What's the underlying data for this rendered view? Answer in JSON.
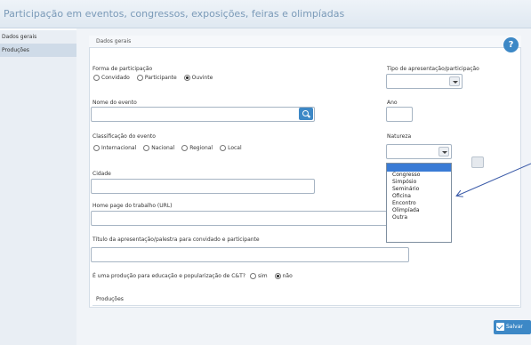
{
  "header": {
    "title": "Participação em eventos, congressos, exposições, feiras e olimpíadas"
  },
  "sidebar": {
    "items": [
      {
        "label": "Dados gerais"
      },
      {
        "label": "Produções"
      }
    ]
  },
  "tab": {
    "label": "Dados gerais"
  },
  "form": {
    "forma_participacao": {
      "label": "Forma de participação",
      "options": [
        {
          "label": "Convidado"
        },
        {
          "label": "Participante"
        },
        {
          "label": "Ouvinte",
          "selected": true
        }
      ]
    },
    "tipo_apresentacao": {
      "label": "Tipo de apresentação/participação",
      "value": ""
    },
    "nome_evento": {
      "label": "Nome do evento",
      "value": ""
    },
    "ano": {
      "label": "Ano",
      "value": ""
    },
    "classificacao": {
      "label": "Classificação do evento",
      "options": [
        {
          "label": "Internacional"
        },
        {
          "label": "Nacional"
        },
        {
          "label": "Regional"
        },
        {
          "label": "Local"
        }
      ]
    },
    "natureza": {
      "label": "Natureza",
      "value": "",
      "options": [
        "",
        "Congresso",
        "Simpósio",
        "Seminário",
        "Oficina",
        "Encontro",
        "Olimpíada",
        "Outra"
      ]
    },
    "cidade": {
      "label": "Cidade",
      "value": ""
    },
    "home_page": {
      "label": "Home page do trabalho (URL)",
      "value": ""
    },
    "titulo_apresentacao": {
      "label": "Título da apresentação/palestra para convidado e participante",
      "value": ""
    },
    "producao_educacao": {
      "label": "É uma produção para educação e popularização de C&T?",
      "options": [
        {
          "label": "sim"
        },
        {
          "label": "não",
          "selected": true
        }
      ]
    }
  },
  "section": {
    "producoes": "Produções"
  },
  "footer": {
    "save_label": "Salvar"
  }
}
